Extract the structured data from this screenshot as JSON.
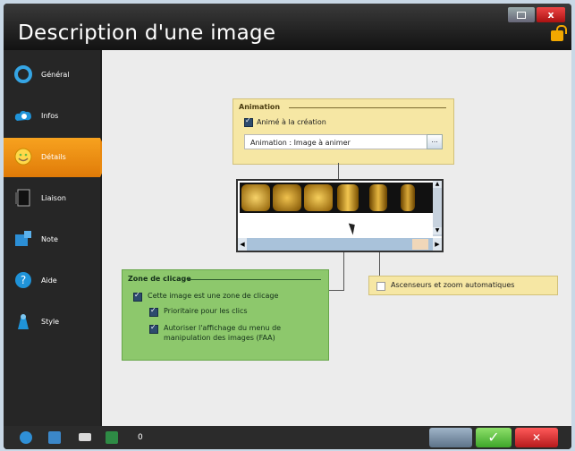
{
  "window": {
    "title": "Description d'une image",
    "close_label": "x"
  },
  "sidebar": {
    "items": [
      {
        "label": "Général",
        "icon": "ring-icon"
      },
      {
        "label": "Infos",
        "icon": "cloud-icon"
      },
      {
        "label": "Détails",
        "icon": "smiley-icon",
        "active": true
      },
      {
        "label": "Liaison",
        "icon": "page-icon"
      },
      {
        "label": "Note",
        "icon": "puzzle-icon"
      },
      {
        "label": "Aide",
        "icon": "help-icon"
      },
      {
        "label": "Style",
        "icon": "palette-icon"
      }
    ]
  },
  "animation": {
    "title": "Animation",
    "checkbox_label": "Animé à la création",
    "field_value": "Animation : Image à animer",
    "browse_label": "..."
  },
  "clickzone": {
    "title": "Zone de clicage",
    "items": [
      {
        "label": "Cette image est une zone de clicage",
        "checked": true
      },
      {
        "label": "Prioritaire pour les clics",
        "checked": true
      },
      {
        "label": "Autoriser l'affichage du menu de manipulation des images (FAA)",
        "checked": true
      }
    ]
  },
  "auto_scroll": {
    "label": "Ascenseurs et zoom automatiques",
    "checked": false
  },
  "taskbar": {
    "counter": "0"
  },
  "colors": {
    "accent": "#f39a1a",
    "animation_panel": "#f6e7a4",
    "clickzone_panel": "#8dc86c",
    "ok_button": "#5bbf3d",
    "cancel_button": "#d8282c"
  }
}
